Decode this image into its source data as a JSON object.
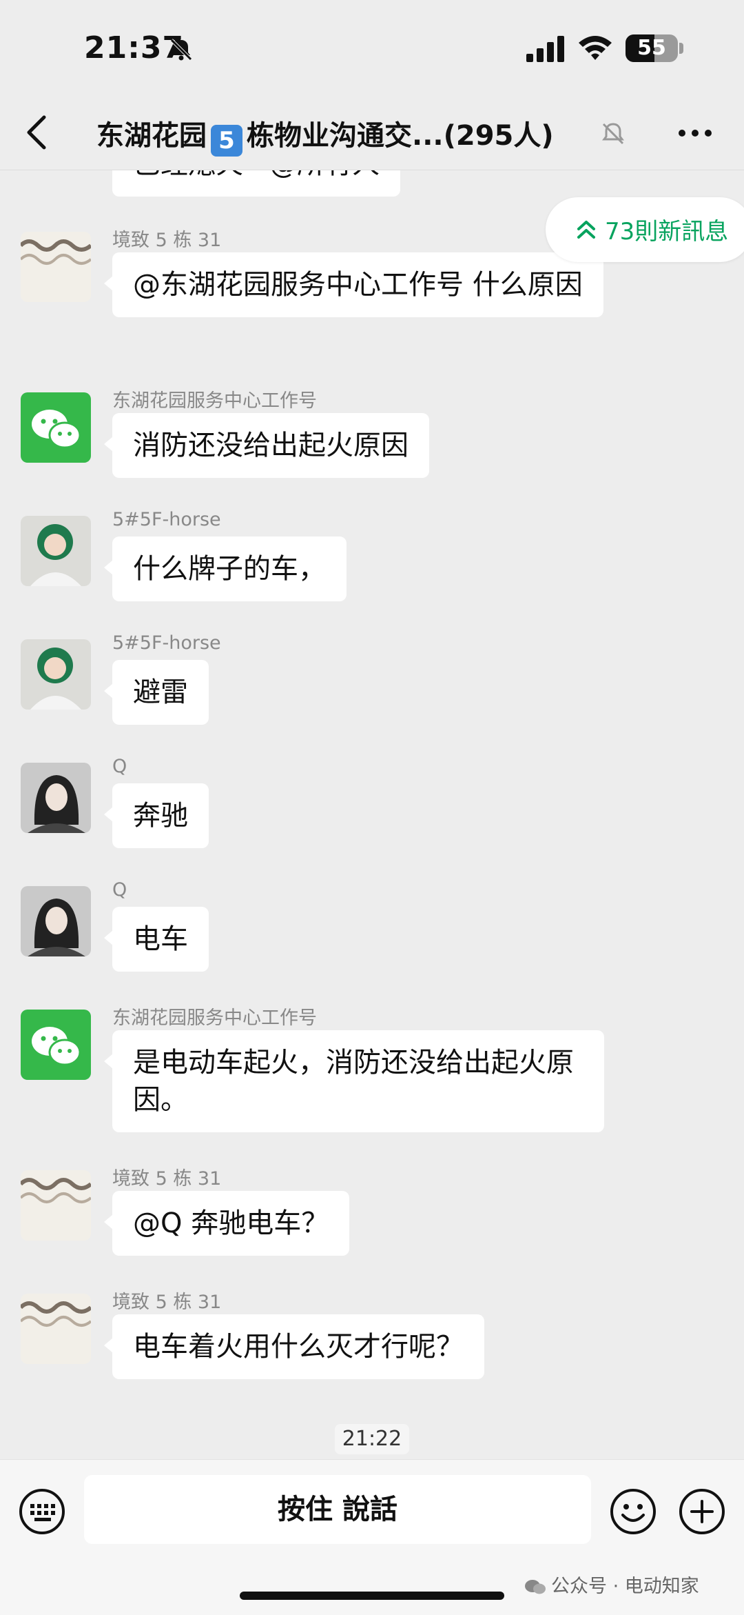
{
  "status_bar": {
    "time": "21:37",
    "battery": "55",
    "battery_level": 0.55
  },
  "header": {
    "title_prefix": "东湖花园",
    "title_badge": "5",
    "title_suffix": "栋物业沟通交...(295人)",
    "muted": true
  },
  "new_messages": {
    "label": "73則新訊息"
  },
  "cut_message": {
    "text": "已经熄火 · @所有人"
  },
  "messages": [
    {
      "sender": "境致 5 栋 31",
      "text": "@东湖花园服务中心工作号 什么原因",
      "avatar": "stripes-avatar"
    },
    {
      "sender": "东湖花园服务中心工作号",
      "text": "消防还没给出起火原因",
      "avatar": "wechat-avatar"
    },
    {
      "sender": "5#5F-horse",
      "text": "什么牌子的车，",
      "avatar": "girl-green-hood-avatar"
    },
    {
      "sender": "5#5F-horse",
      "text": "避雷",
      "avatar": "girl-green-hood-avatar"
    },
    {
      "sender": "Q",
      "text": "奔驰",
      "avatar": "girl-dark-hair-avatar"
    },
    {
      "sender": "Q",
      "text": "电车",
      "avatar": "girl-dark-hair-avatar"
    },
    {
      "sender": "东湖花园服务中心工作号",
      "text": "是电动车起火，消防还没给出起火原因。",
      "avatar": "wechat-avatar"
    },
    {
      "sender": "境致 5 栋 31",
      "text": "@Q 奔驰电车？",
      "avatar": "stripes-avatar"
    },
    {
      "sender": "境致 5 栋 31",
      "text": "电车着火用什么灭才行呢？",
      "avatar": "stripes-avatar"
    }
  ],
  "timestamp": "21:22",
  "input_bar": {
    "hold_to_talk": "按住 說話"
  },
  "watermark": "公众号 · 电动知家",
  "colors": {
    "background": "#ededed",
    "accent_green": "#07a35e",
    "wechat_green": "#35b84a"
  }
}
